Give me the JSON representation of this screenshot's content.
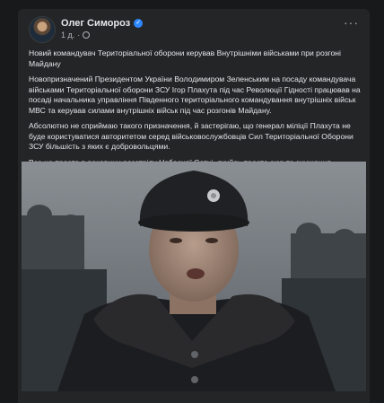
{
  "post": {
    "author": "Олег Симороз",
    "time": "1 д.",
    "paragraphs": [
      "Новий командувач Територіальної оборони керував Внутрішніми військами при розгоні Майдану",
      "Новопризначений Президентом України Володимиром Зеленським на посаду командувача військами Територіальної оборони ЗСУ Ігор Плахута під час Революції Гідності працював на посаді начальника управління Південного територіального командування внутрішніх військ МВС та керував силами внутрішніх військ під час розгонів Майдану.",
      "Абсолютно не сприймаю такого призначення, й застерігаю, що генерал міліції Плахута не буде користуватися авторитетом серед військовослужбовців Сил Територіальної Оборони ЗСУ більшість з яких є добровольцями.",
      "Все це просто в роковини розстрілу Небесної Сотні, якийсь просто сюр та знущання..."
    ]
  },
  "icons": {
    "verified": "verified-badge-icon",
    "audience": "globe-icon",
    "menu": "more-options-icon"
  },
  "colors": {
    "background": "#18191a",
    "card": "#242526",
    "text": "#e4e6eb",
    "secondary_text": "#b0b3b8",
    "accent": "#2d88ff"
  }
}
